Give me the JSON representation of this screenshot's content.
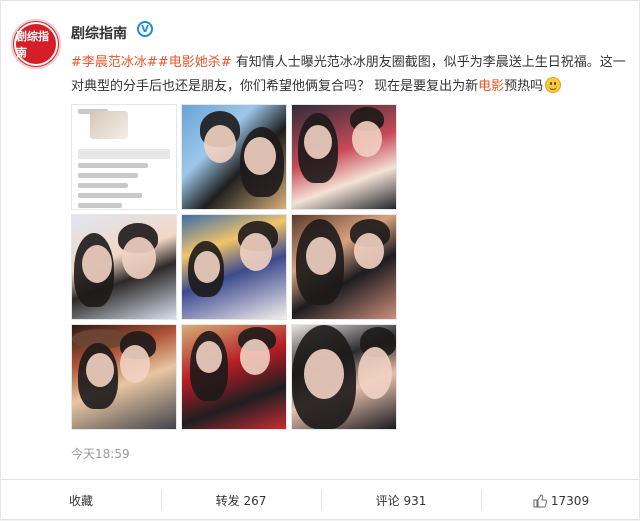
{
  "post": {
    "username": "剧综指南",
    "avatar_text": "剧综指南",
    "verified_icon": "verified-badge-icon",
    "tags": [
      "#李晨范冰冰#",
      "#电影她杀#"
    ],
    "text_parts": [
      "有知情人士曝光范冰冰朋友圈截图，似乎为李晨送上生日祝福。这一对典型的分手后也还是朋友，你们希望他俩复合吗？ 现在是要复出为新",
      "电影",
      "预热吗"
    ],
    "emoji": "smile-emoji-icon",
    "timestamp": "今天18:59"
  },
  "actions": {
    "collect": "收藏",
    "repost": "转发 267",
    "comment": "评论 931",
    "like_count": "17309",
    "like_icon": "thumbs-up-icon"
  },
  "colors": {
    "tag_color": "#e8562a",
    "avatar_bg": "#d41f2a",
    "verified": "#1e88e5"
  }
}
